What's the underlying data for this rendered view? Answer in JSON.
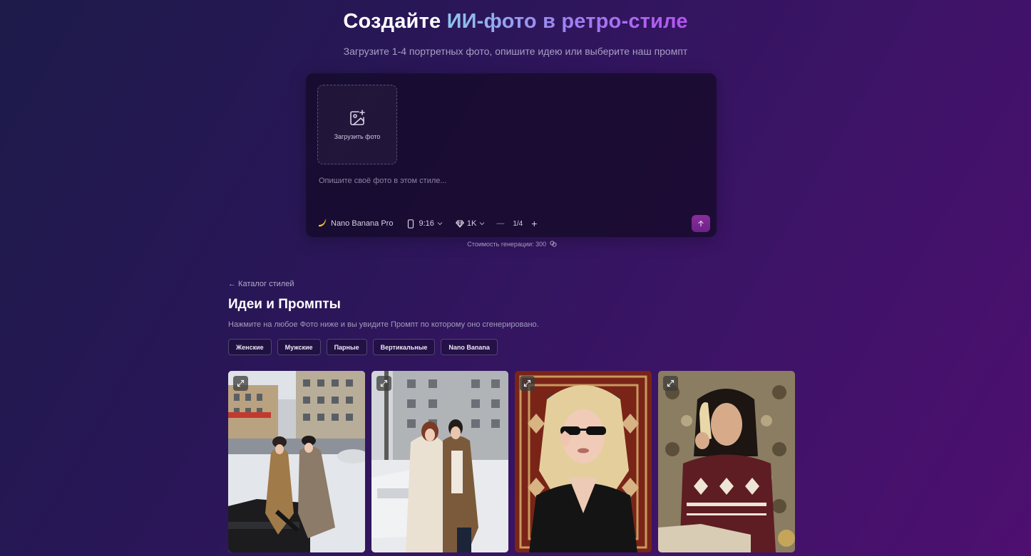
{
  "hero": {
    "title_plain": "Создайте ",
    "title_highlight": "ИИ-фото в ретро-стиле",
    "subtitle": "Загрузите 1-4 портретных фото, опишите идею или выберите наш промпт"
  },
  "composer": {
    "upload_label": "Загрузить фото",
    "prompt_placeholder": "Опишите своё фото в этом стиле...",
    "model": {
      "icon": "banana-icon",
      "label": "Nano Banana Pro"
    },
    "aspect": {
      "icon": "phone-icon",
      "label": "9:16"
    },
    "quality": {
      "icon": "diamond-icon",
      "label": "1K"
    },
    "count": {
      "minus": "—",
      "value": "1/4",
      "plus": "+"
    },
    "cost": "Стоимость генерации: 300"
  },
  "catalog": {
    "back_label": "← Каталог стилей",
    "title": "Идеи и Промпты",
    "subtitle": "Нажмите на любое Фото ниже и вы увидите Промпт по которому оно сгенерировано.",
    "filters": [
      {
        "label": "Женские"
      },
      {
        "label": "Мужские"
      },
      {
        "label": "Парные"
      },
      {
        "label": "Вертикальные"
      },
      {
        "label": "Nano Banana"
      }
    ]
  },
  "colors": {
    "accent": "#8a2d9c",
    "gradient_start": "#8ec5ec",
    "gradient_end": "#b554f0"
  }
}
